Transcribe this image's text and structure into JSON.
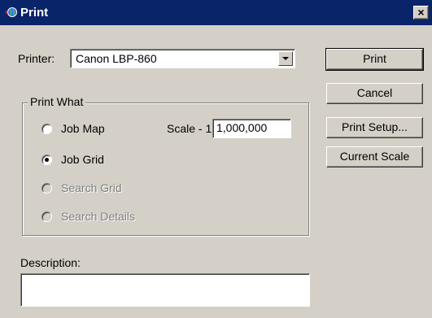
{
  "window": {
    "title": "Print",
    "close_glyph": "×"
  },
  "printer": {
    "label": "Printer:",
    "selected": "Canon LBP-860"
  },
  "print_what": {
    "legend": "Print What",
    "options": [
      {
        "label": "Job Map",
        "checked": false,
        "disabled": false
      },
      {
        "label": "Job Grid",
        "checked": true,
        "disabled": false
      },
      {
        "label": "Search Grid",
        "checked": false,
        "disabled": true
      },
      {
        "label": "Search Details",
        "checked": false,
        "disabled": true
      }
    ],
    "scale_label": "Scale - 1:",
    "scale_value": "1,000,000"
  },
  "description": {
    "label": "Description:",
    "value": ""
  },
  "buttons": {
    "print": "Print",
    "cancel": "Cancel",
    "print_setup": "Print Setup...",
    "current_scale": "Current Scale"
  },
  "icons": {
    "title_icon": "app-globe-icon"
  },
  "colors": {
    "titlebar": "#0a246a",
    "face": "#d4d0c8",
    "disabled_text": "#808080"
  }
}
